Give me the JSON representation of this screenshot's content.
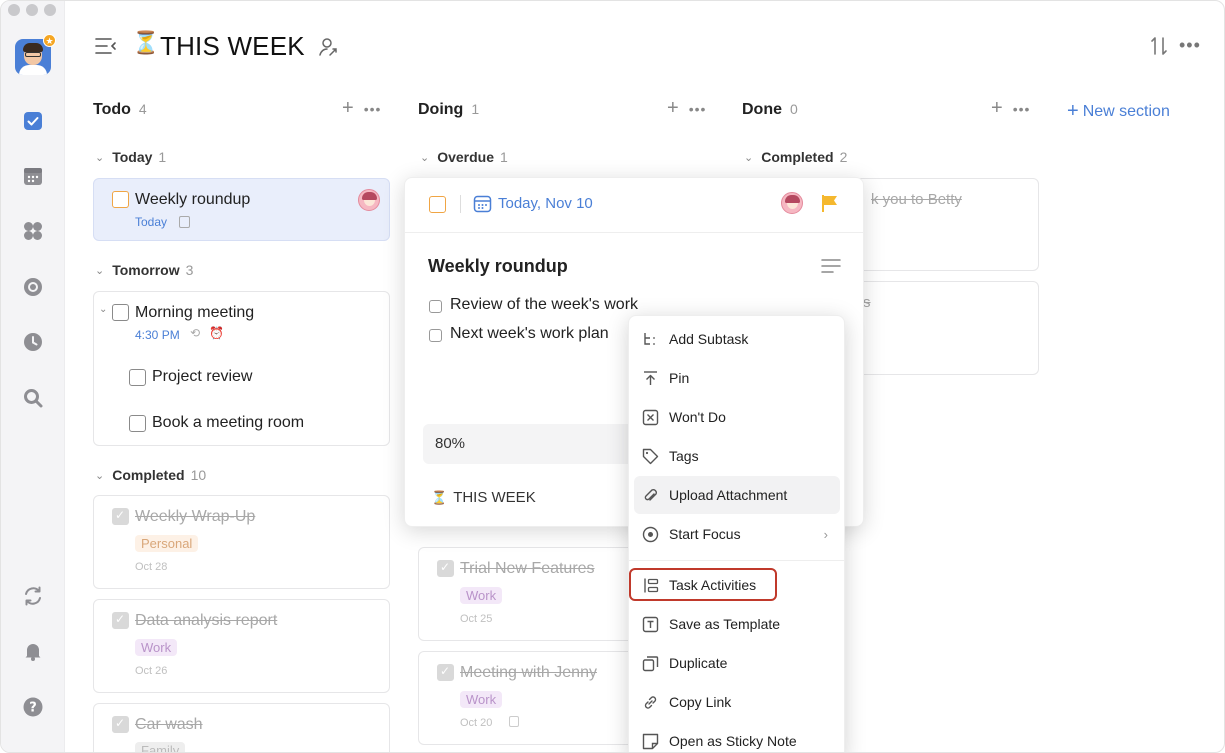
{
  "header": {
    "title": "THIS WEEK"
  },
  "columns": [
    {
      "name": "Todo",
      "count": "4"
    },
    {
      "name": "Doing",
      "count": "1"
    },
    {
      "name": "Done",
      "count": "0"
    }
  ],
  "new_section_label": "New section",
  "todo": {
    "today": {
      "label": "Today",
      "count": "1"
    },
    "weekly": {
      "title": "Weekly roundup",
      "date": "Today"
    },
    "tomorrow": {
      "label": "Tomorrow",
      "count": "3"
    },
    "meeting": {
      "title": "Morning meeting",
      "time": "4:30 PM"
    },
    "sub1": "Project review",
    "sub2": "Book a meeting room",
    "completed": {
      "label": "Completed",
      "count": "10"
    },
    "done_tasks": [
      {
        "title": "Weekly Wrap-Up",
        "tag": "Personal",
        "date": "Oct 28"
      },
      {
        "title": "Data analysis report",
        "tag": "Work",
        "date": "Oct 26"
      },
      {
        "title": "Car wash",
        "tag": "Family"
      }
    ]
  },
  "doing": {
    "overdue": {
      "label": "Overdue",
      "count": "1"
    },
    "done_tasks": [
      {
        "title": "Trial New Features",
        "tag": "Work",
        "date": "Oct 25"
      },
      {
        "title": "Meeting with Jenny",
        "tag": "Work",
        "date": "Oct 20"
      }
    ]
  },
  "done": {
    "completed": {
      "label": "Completed",
      "count": "2"
    },
    "task1_partial": "k you to Betty",
    "task2_partial": "s"
  },
  "detail": {
    "date": "Today, Nov 10",
    "title": "Weekly roundup",
    "subtasks": [
      "Review of the week's work",
      "Next week's work plan"
    ],
    "progress": "80%",
    "project": "THIS WEEK"
  },
  "context_menu": {
    "items": [
      {
        "label": "Add Subtask",
        "icon": "subtask-icon"
      },
      {
        "label": "Pin",
        "icon": "pin-icon"
      },
      {
        "label": "Won't Do",
        "icon": "wont-do-icon"
      },
      {
        "label": "Tags",
        "icon": "tag-icon"
      },
      {
        "label": "Upload Attachment",
        "icon": "paperclip-icon"
      },
      {
        "label": "Start Focus",
        "icon": "focus-icon"
      },
      {
        "label": "Task Activities",
        "icon": "activities-icon"
      },
      {
        "label": "Save as Template",
        "icon": "template-icon"
      },
      {
        "label": "Duplicate",
        "icon": "duplicate-icon"
      },
      {
        "label": "Copy Link",
        "icon": "link-icon"
      },
      {
        "label": "Open as Sticky Note",
        "icon": "sticky-note-icon"
      }
    ]
  },
  "colors": {
    "accent": "#4a7fd6",
    "flag": "#f5b82e",
    "highlight": "#c0392b"
  }
}
